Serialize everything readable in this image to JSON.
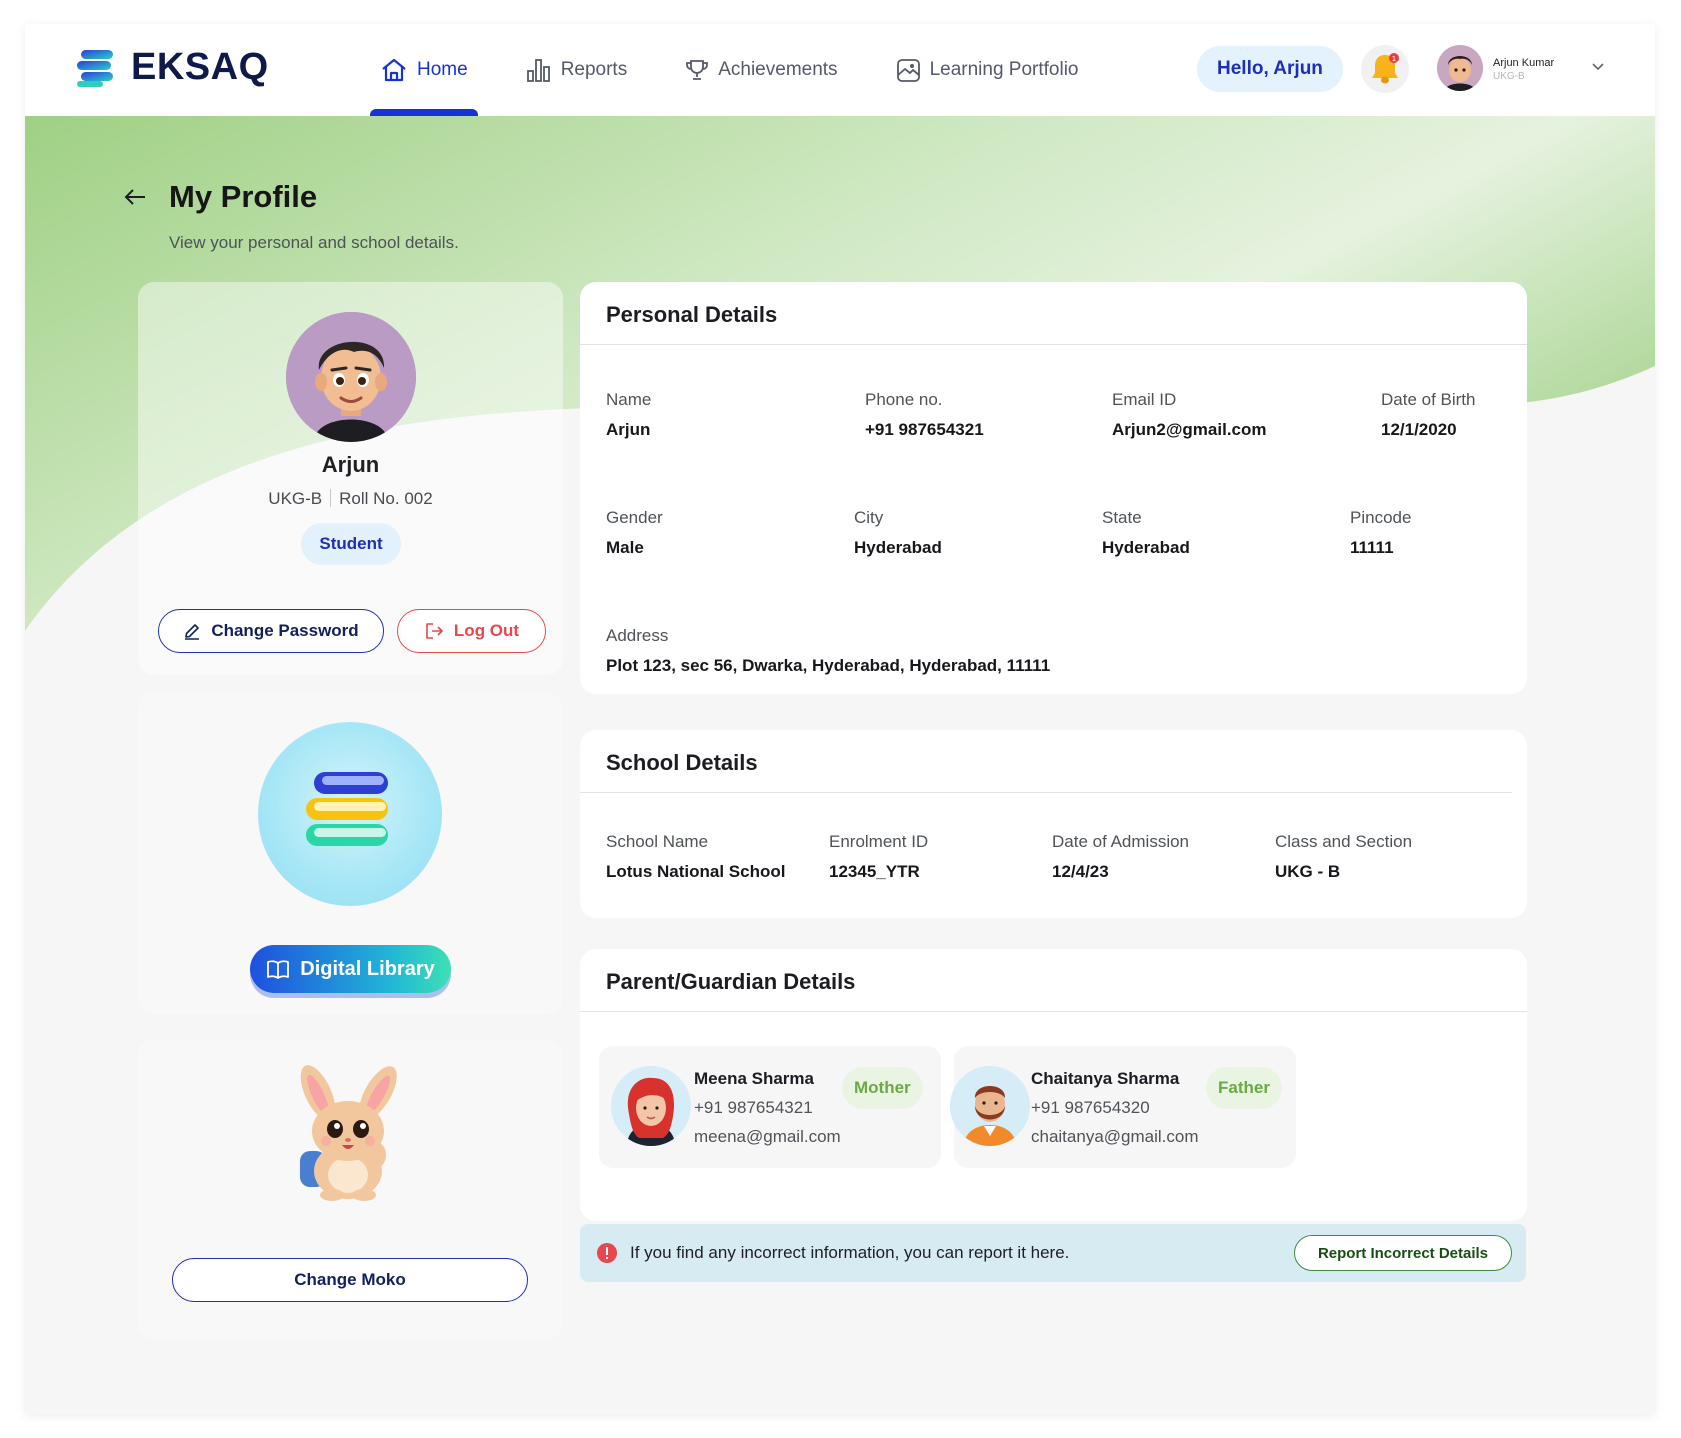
{
  "colors": {
    "brand_navy": "#0f1a4b",
    "accent_blue": "#1733d6",
    "header_green": "#9fd084",
    "danger": "#e5484d",
    "relation_green": "#6aaa45"
  },
  "header": {
    "brand": "EKSAQ",
    "nav": [
      {
        "label": "Home",
        "icon": "home-icon",
        "active": true
      },
      {
        "label": "Reports",
        "icon": "bar-chart-icon",
        "active": false
      },
      {
        "label": "Achievements",
        "icon": "trophy-icon",
        "active": false
      },
      {
        "label": "Learning Portfolio",
        "icon": "portfolio-icon",
        "active": false
      }
    ],
    "greeting": "Hello, Arjun",
    "notification_icon": "bell-icon",
    "user": {
      "name": "Arjun Kumar",
      "class": "UKG-B"
    }
  },
  "page": {
    "title": "My Profile",
    "subtitle": "View your personal and school details."
  },
  "profile": {
    "name": "Arjun",
    "class": "UKG-B",
    "roll": "Roll No. 002",
    "role": "Student",
    "change_password": "Change Password",
    "logout": "Log Out"
  },
  "library": {
    "button": "Digital Library"
  },
  "moko": {
    "button": "Change Moko"
  },
  "personal": {
    "title": "Personal Details",
    "fields": [
      {
        "label": "Name",
        "value": "Arjun"
      },
      {
        "label": "Phone no.",
        "value": "+91 987654321"
      },
      {
        "label": "Email ID",
        "value": "Arjun2@gmail.com"
      },
      {
        "label": "Date of Birth",
        "value": "12/1/2020"
      },
      {
        "label": "Gender",
        "value": "Male"
      },
      {
        "label": "City",
        "value": "Hyderabad"
      },
      {
        "label": "State",
        "value": "Hyderabad"
      },
      {
        "label": "Pincode",
        "value": "11111"
      },
      {
        "label": "Address",
        "value": "Plot 123, sec 56, Dwarka, Hyderabad, Hyderabad, 11111"
      }
    ]
  },
  "school": {
    "title": "School Details",
    "fields": [
      {
        "label": "School Name",
        "value": "Lotus National School"
      },
      {
        "label": "Enrolment ID",
        "value": "12345_YTR"
      },
      {
        "label": "Date of Admission",
        "value": "12/4/23"
      },
      {
        "label": "Class and Section",
        "value": "UKG - B"
      }
    ]
  },
  "parents": {
    "title": "Parent/Guardian Details",
    "list": [
      {
        "name": "Meena Sharma",
        "relation": "Mother",
        "phone": "+91 987654321",
        "email": "meena@gmail.com"
      },
      {
        "name": "Chaitanya Sharma",
        "relation": "Father",
        "phone": "+91 987654320",
        "email": "chaitanya@gmail.com"
      }
    ]
  },
  "report": {
    "text": "If you find any incorrect information, you can report it here.",
    "button": "Report Incorrect Details"
  }
}
